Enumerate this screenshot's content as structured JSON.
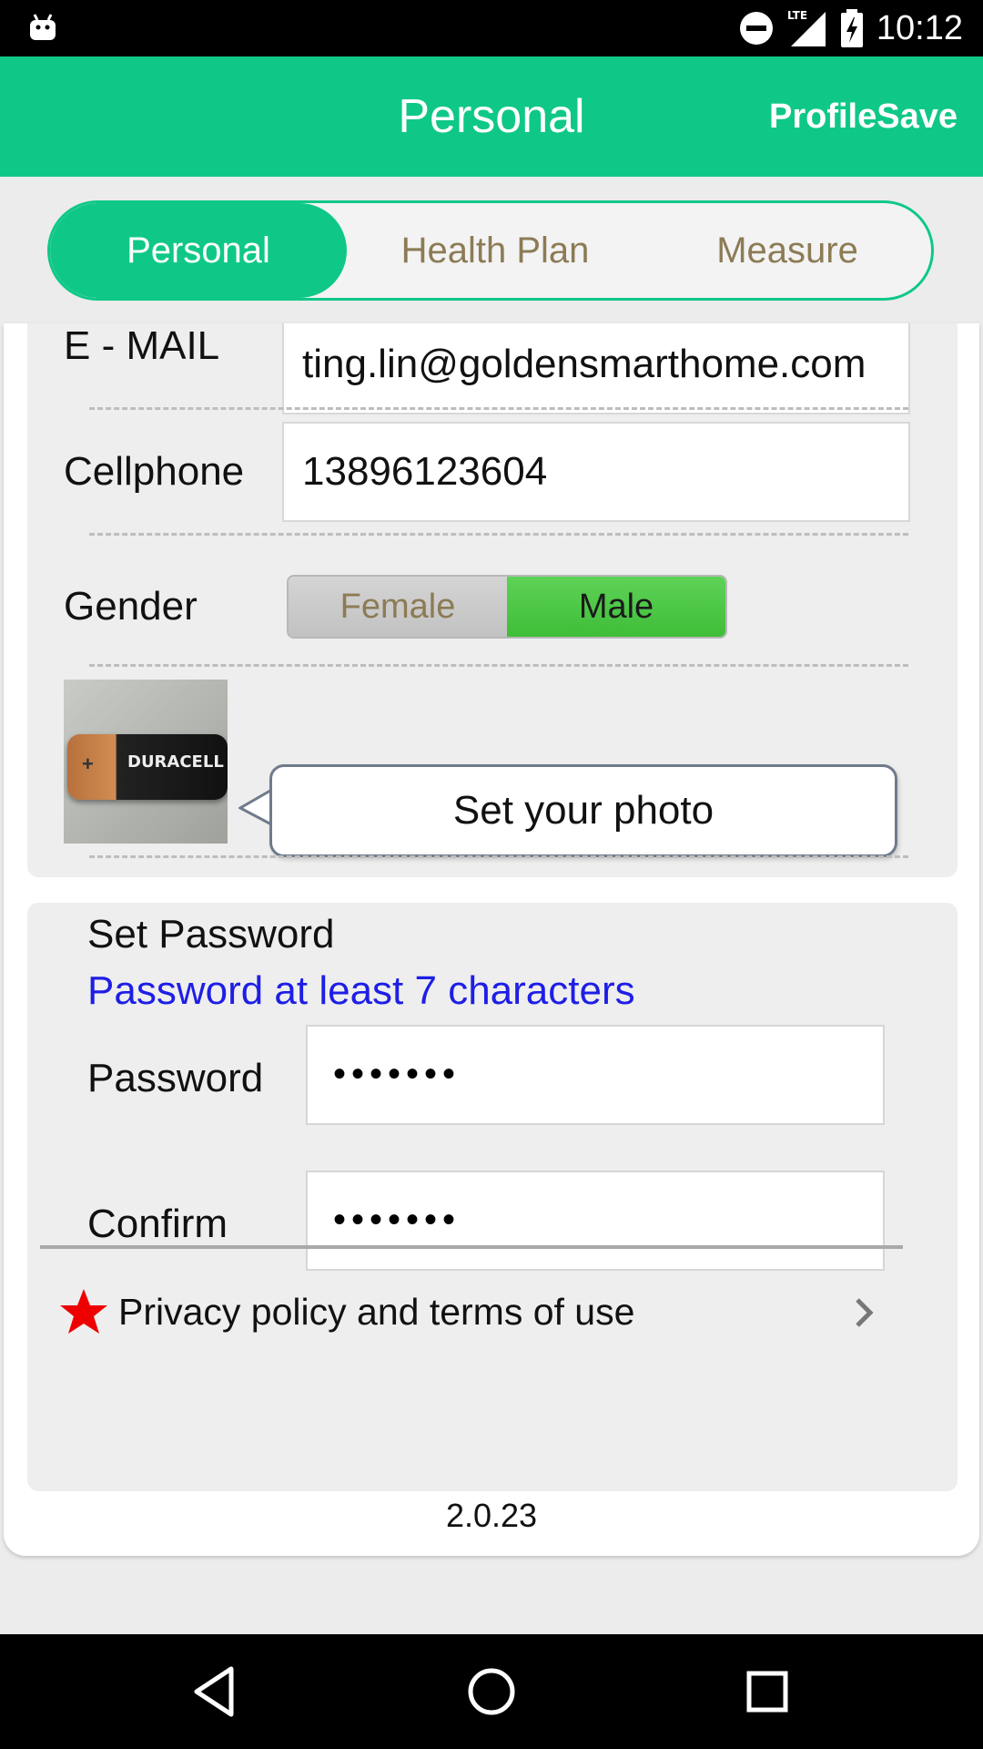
{
  "status_bar": {
    "time": "10:12",
    "network": "LTE",
    "icons": [
      "android-debug-icon",
      "do-not-disturb-icon",
      "signal-icon",
      "battery-charging-icon"
    ]
  },
  "app_bar": {
    "title": "Personal",
    "action_label": "ProfileSave",
    "background": "#0fc887"
  },
  "tabs": [
    {
      "label": "Personal",
      "active": true
    },
    {
      "label": "Health Plan",
      "active": false
    },
    {
      "label": "Measure",
      "active": false
    }
  ],
  "profile": {
    "email_label": "E  -  MAIL",
    "email_value": "ting.lin@goldensmarthome.com",
    "cellphone_label": "Cellphone",
    "cellphone_value": "13896123604",
    "gender_label": "Gender",
    "gender_options": [
      "Female",
      "Male"
    ],
    "gender_selected": "Male",
    "photo_button": "Set your photo",
    "photo_brand": "DURACELL"
  },
  "password": {
    "title": "Set Password",
    "hint": "Password at least 7 characters",
    "password_label": "Password",
    "password_value": "•••••••",
    "confirm_label": "Confirm",
    "confirm_value": "•••••••"
  },
  "privacy_label": "Privacy policy and terms of use",
  "version": "2.0.23",
  "nav": [
    "back-icon",
    "home-icon",
    "recents-icon"
  ]
}
